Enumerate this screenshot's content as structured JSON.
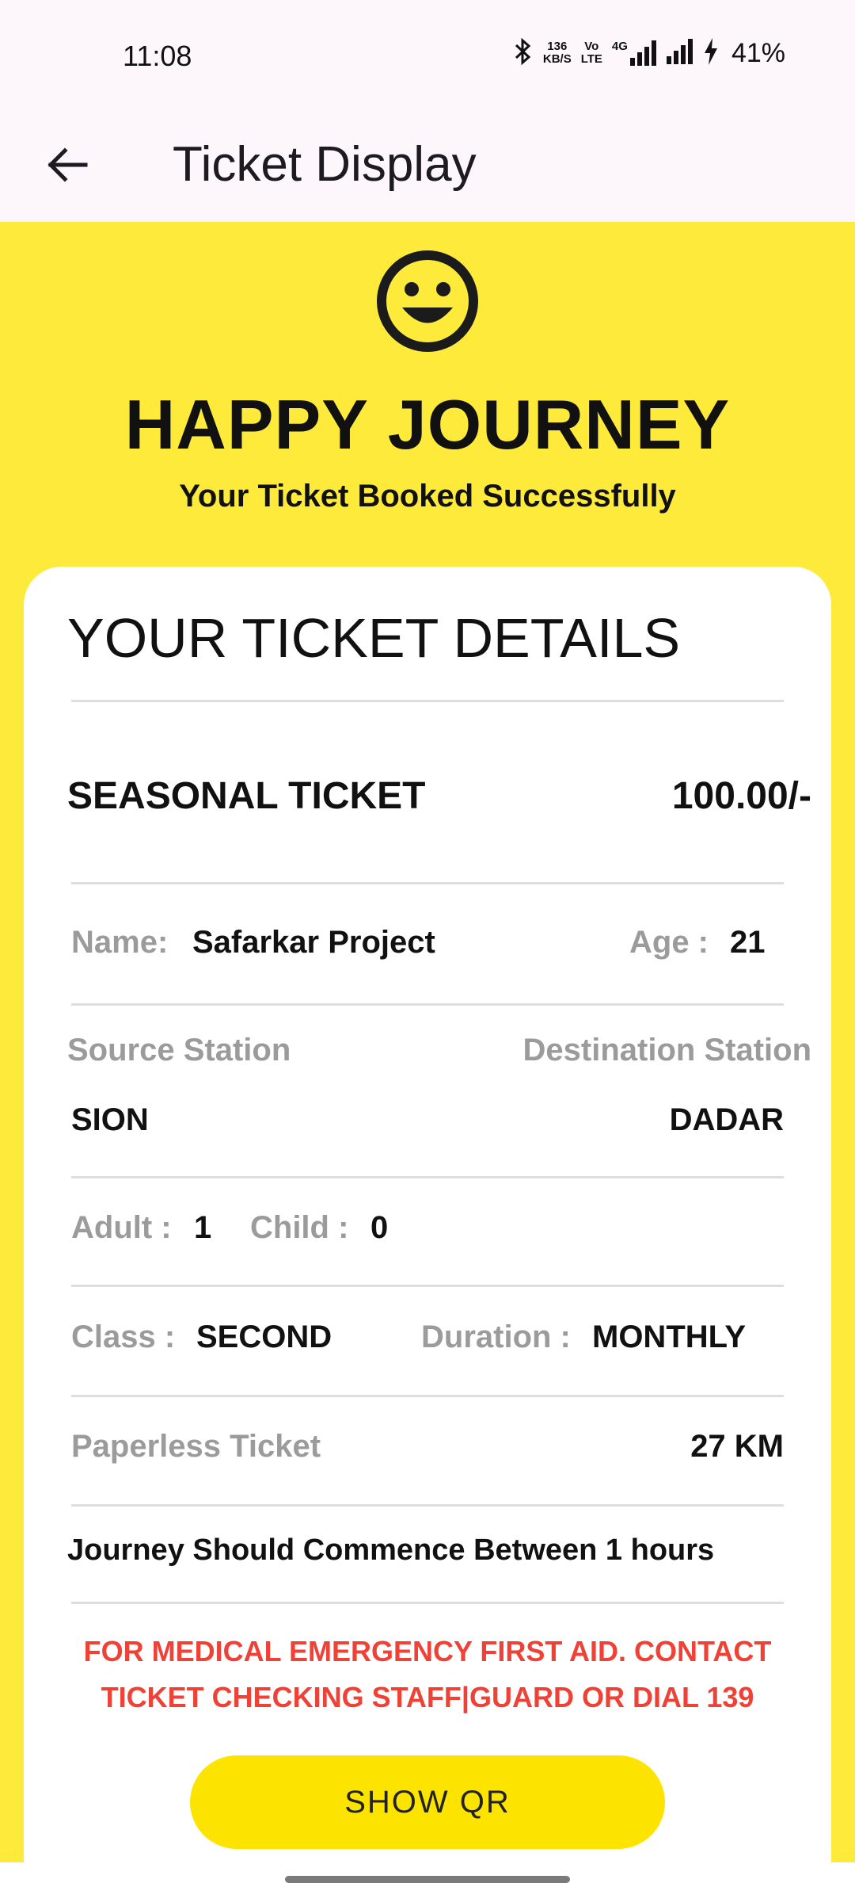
{
  "status_bar": {
    "time": "11:08",
    "net_speed_top": "136",
    "net_speed_bottom": "KB/S",
    "volte_top": "Vo",
    "volte_bottom": "LTE",
    "network": "4G",
    "battery": "41%"
  },
  "app_bar": {
    "title": "Ticket Display"
  },
  "hero": {
    "title": "HAPPY JOURNEY",
    "subtitle": "Your Ticket Booked Successfully"
  },
  "card": {
    "title": "YOUR TICKET DETAILS",
    "ticket_type": "SEASONAL TICKET",
    "price": "100.00/-",
    "name_label": "Name:",
    "name_value": "Safarkar Project",
    "age_label": "Age :",
    "age_value": "21",
    "source_label": "Source Station",
    "destination_label": "Destination Station",
    "source_value": "SION",
    "destination_value": "DADAR",
    "adult_label": "Adult :",
    "adult_value": "1",
    "child_label": "Child :",
    "child_value": "0",
    "class_label": "Class :",
    "class_value": "SECOND",
    "duration_label": "Duration :",
    "duration_value": "MONTHLY",
    "paperless_label": "Paperless Ticket",
    "distance": "27 KM",
    "journey_note": "Journey Should Commence Between 1 hours",
    "warning_line1": "FOR MEDICAL EMERGENCY FIRST AID. CONTACT",
    "warning_line2": "TICKET CHECKING STAFF|GUARD OR DIAL 139",
    "qr_button": "SHOW QR"
  },
  "colors": {
    "accent_yellow": "#fdea3b",
    "button_yellow": "#fde400",
    "warning_red": "#ef4136"
  }
}
